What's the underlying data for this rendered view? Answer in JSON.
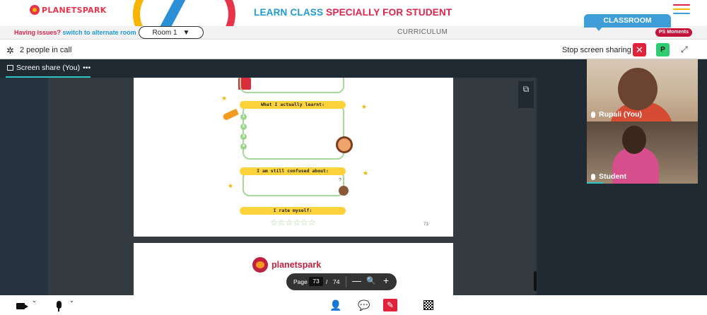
{
  "header": {
    "logo_text": "PLANETSPARK",
    "headline_part1": "LEARN CLASS ",
    "headline_part2": "SPECIALLY FOR STUDENT",
    "hamburger_colors": [
      "#e0234b",
      "#f7b500",
      "#3f9ed8"
    ],
    "menu_icon": "hamburger-icon"
  },
  "subbar": {
    "issue_text": "Having issues?",
    "switch_link": "switch to alternate room",
    "room_value": "Room 1",
    "room_caret": "▼",
    "curriculum_label": "CURRICULUM",
    "classroom_label": "CLASSROOM",
    "ps_moments_label": "PS Moments"
  },
  "call": {
    "people_count": "2 people in call",
    "stop_share_label": "Stop screen sharing",
    "stop_share_icon": "close-icon",
    "stop_share_glyph": "✕",
    "participant_badge": "P",
    "expand_glyph": "⤢",
    "settings_glyph": "✲",
    "tab_label": "Screen share (You)",
    "tab_more": "•••",
    "popout_glyph": "⧉"
  },
  "worksheet": {
    "actually_learnt": "What I actually learnt:",
    "numbers": [
      "1",
      "2",
      "3",
      "4"
    ],
    "still_confused": "I am still confused about:",
    "rate_myself": "I rate myself:",
    "stars_glyph": "☆☆☆☆☆☆",
    "page_number": "73",
    "question_mark": "?"
  },
  "next_page": {
    "brand": "planetspark"
  },
  "pdf_controls": {
    "page_label": "Page",
    "current_page": "73",
    "separator": "/",
    "total_pages": "74",
    "minus_glyph": "—",
    "zoom_glyph": "🔍",
    "plus_glyph": "+"
  },
  "tiles": [
    {
      "name": "Rupali (You)"
    },
    {
      "name": "Student"
    }
  ],
  "bottombar": {
    "camera_icon": "camera-icon",
    "mic_icon": "microphone-icon",
    "person_glyph": "👤",
    "chat_glyph": "💬",
    "share_glyph": "✎",
    "chevron_glyph": "⌄"
  },
  "colors": {
    "brand_red": "#e0234b",
    "brand_blue": "#1e9bd7",
    "classroom_tab": "#3f9ed8",
    "call_bg": "#1f2a33",
    "accent_teal": "#2ec4c4",
    "stop_red": "#e0233b",
    "badge_green": "#2ecc71"
  }
}
